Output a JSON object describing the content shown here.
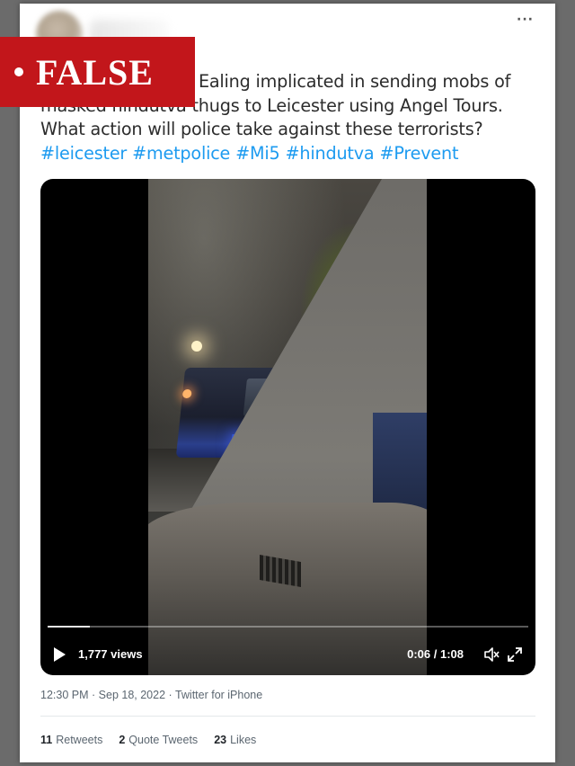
{
  "tweet": {
    "text_lines": [
      "A Hindu Temple in Ealing implicated in sending mobs of",
      "masked hindutva thugs to Leicester using Angel Tours.",
      "What action will police take against these terrorists?"
    ],
    "hashtags": [
      "#leicester",
      "#metpolice",
      "#Mi5",
      "#hindutva",
      "#Prevent"
    ],
    "more_label": "···"
  },
  "video": {
    "banner_label": "FALSE",
    "views": "1,777 views",
    "time": "0:06 / 1:08",
    "progress": 0.088,
    "icons": {
      "play": "play-icon",
      "mute": "volume-muted-icon",
      "fullscreen": "expand-icon"
    }
  },
  "meta": {
    "time": "12:30 PM",
    "date": "Sep 18, 2022",
    "source": "Twitter for iPhone",
    "separator": "·"
  },
  "stats": {
    "retweets_count": "11",
    "retweets_label": "Retweets",
    "quotes_count": "2",
    "quotes_label": "Quote Tweets",
    "likes_count": "23",
    "likes_label": "Likes"
  },
  "colors": {
    "hashtag": "#1d9bf0",
    "banner": "#c2161b",
    "backdrop": "#6b6b6b"
  }
}
